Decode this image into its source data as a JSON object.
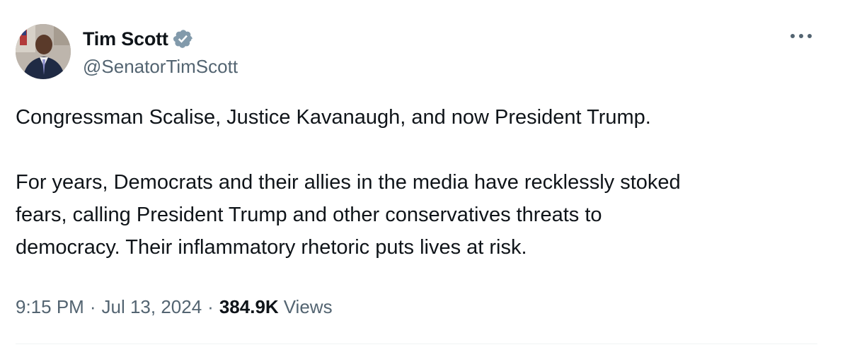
{
  "author": {
    "display_name": "Tim Scott",
    "handle": "@SenatorTimScott",
    "verified": true,
    "avatar": "profile-photo"
  },
  "tweet": {
    "paragraphs": [
      "Congressman Scalise, Justice Kavanaugh, and now President Trump.",
      "For years, Democrats and their allies in the media have recklessly stoked\nfears, calling President Trump and other conservatives threats to\ndemocracy. Their inflammatory rhetoric puts lives at risk."
    ]
  },
  "meta": {
    "time": "9:15 PM",
    "separator": "·",
    "date": "Jul 13, 2024",
    "views_count": "384.9K",
    "views_label": "Views"
  },
  "icons": {
    "verified": "verified-badge-icon",
    "more": "more-options-icon"
  },
  "colors": {
    "primary_text": "#0f1419",
    "secondary_text": "#536471",
    "verified_badge": "#829aab",
    "divider": "#eff3f4"
  }
}
